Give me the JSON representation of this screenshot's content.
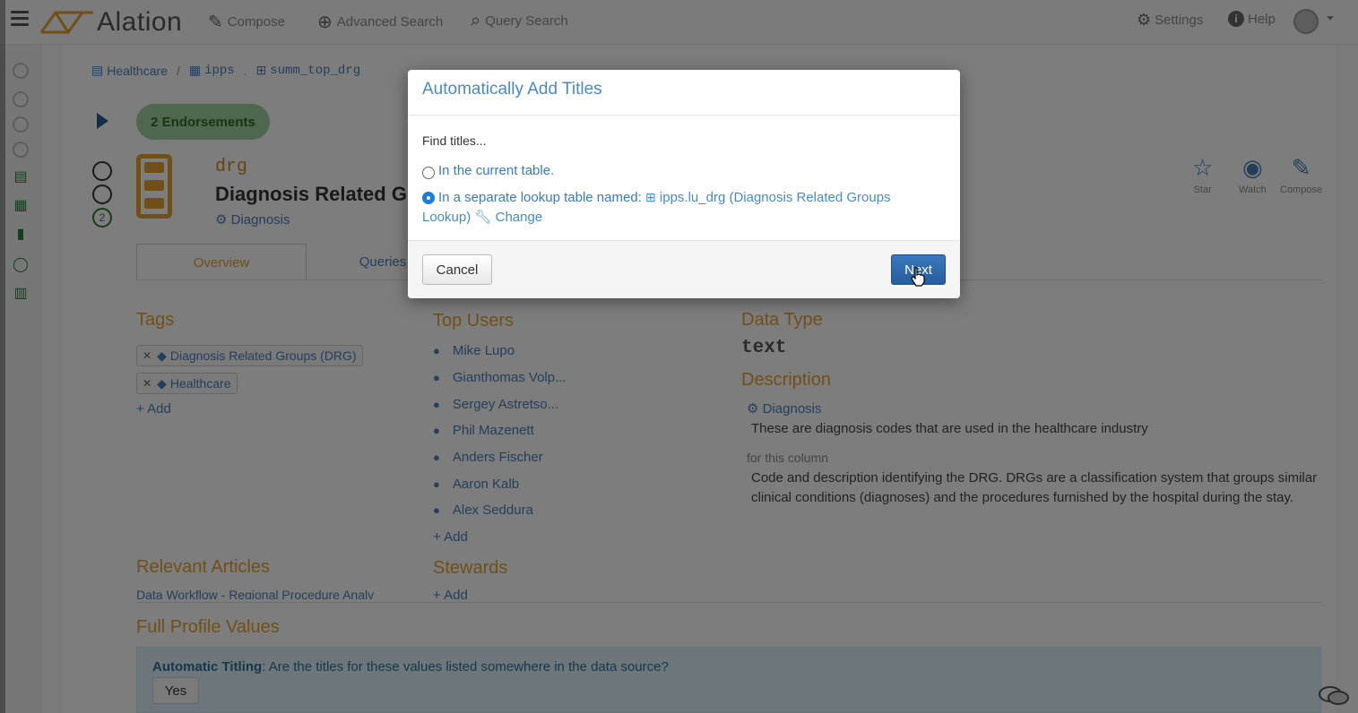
{
  "nav": {
    "brand": "Alation",
    "compose": "Compose",
    "advanced_search": "Advanced Search",
    "query_search": "Query Search",
    "settings": "Settings",
    "help": "Help"
  },
  "breadcrumb": {
    "source": "Healthcare",
    "schema": "ipps",
    "table": "summ_top_drg"
  },
  "column": {
    "endorsements": "2 Endorsements",
    "vote_count": "2",
    "name": "drg",
    "title": "Diagnosis Related Gr",
    "domain_tag": "Diagnosis"
  },
  "tabs": {
    "overview": "Overview",
    "queries": "Queries"
  },
  "actions": {
    "star": "Star",
    "watch": "Watch",
    "compose": "Compose"
  },
  "tags": {
    "heading": "Tags",
    "items": [
      "Diagnosis Related Groups (DRG)",
      "Healthcare"
    ],
    "add": "Add"
  },
  "top_users": {
    "heading": "Top Users",
    "users": [
      "Mike Lupo",
      "Gianthomas Volp...",
      "Sergey Astretso...",
      "Phil Mazenett",
      "Anders Fischer",
      "Aaron Kalb",
      "Alex Seddura"
    ],
    "add": "Add"
  },
  "data_type": {
    "heading": "Data Type",
    "value": "text"
  },
  "description": {
    "heading": "Description",
    "domain": "Diagnosis",
    "domain_text": "These are diagnosis codes that are used in the healthcare industry",
    "for_column_label": "for this column",
    "column_text_line1": "Code and description identifying the DRG. DRGs are a classification system that groups similar",
    "column_text_line2": "clinical conditions (diagnoses) and the procedures furnished by the hospital during the stay."
  },
  "relevant_articles": {
    "heading": "Relevant Articles",
    "first": "Data Workflow - Regional Procedure Analy"
  },
  "stewards": {
    "heading": "Stewards",
    "add": "Add"
  },
  "full_profile": {
    "heading": "Full Profile Values",
    "auto_label": "Automatic Titling",
    "auto_question": ": Are the titles for these values listed somewhere in the data source?",
    "yes": "Yes"
  },
  "modal": {
    "title": "Automatically Add Titles",
    "find_label": "Find titles...",
    "option_current": "In the current table.",
    "option_separate": "In a separate lookup table named:",
    "lookup_table": "ipps.lu_drg (Diagnosis Related Groups Lookup)",
    "change": "Change",
    "selected_option": "separate",
    "cancel": "Cancel",
    "next": "Next"
  },
  "colors": {
    "accent_orange": "#e0a030",
    "link_blue": "#4a7db5",
    "primary_button": "#2e6aac",
    "endorse_green": "#9fcf9f"
  }
}
